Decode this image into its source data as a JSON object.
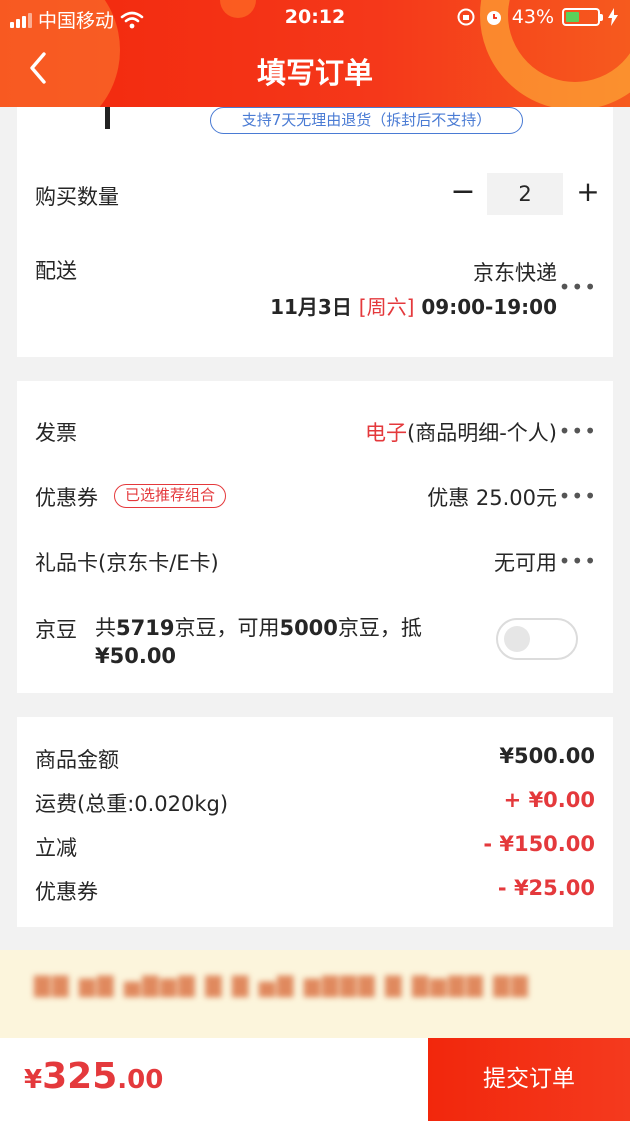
{
  "status_bar": {
    "carrier": "中国移动",
    "time": "20:12",
    "battery": "43%"
  },
  "header": {
    "title": "填写订单"
  },
  "order": {
    "return_policy": "支持7天无理由退货（拆封后不支持）",
    "quantity_label": "购买数量",
    "quantity_value": "2",
    "minus": "−",
    "plus": "+",
    "delivery_label": "配送",
    "delivery_method": "京东快递",
    "delivery_date": "11月3日",
    "delivery_weekday": "[周六]",
    "delivery_time": "09:00-19:00"
  },
  "options": {
    "invoice_label": "发票",
    "invoice_type": "电子",
    "invoice_detail": "(商品明细-个人)",
    "coupon_label": "优惠券",
    "coupon_badge": "已选推荐组合",
    "coupon_value": "优惠 25.00元",
    "giftcard_label": "礼品卡(京东卡/E卡)",
    "giftcard_value": "无可用",
    "jd_bean_label": "京豆",
    "jd_bean_prefix": "共",
    "jd_bean_total": "5719",
    "jd_bean_mid": "京豆，可用",
    "jd_bean_usable": "5000",
    "jd_bean_suffix": "京豆，抵",
    "jd_bean_amount": "¥50.00",
    "jd_bean_enabled": false
  },
  "summary": {
    "items": [
      {
        "label": "商品金额",
        "value": "¥500.00",
        "color": "#262626"
      },
      {
        "label": "运费(总重:0.020kg)",
        "value": "+ ¥0.00",
        "color": "#e4393c"
      },
      {
        "label": "立减",
        "value": "- ¥150.00",
        "color": "#e4393c"
      },
      {
        "label": "优惠券",
        "value": "- ¥25.00",
        "color": "#e4393c"
      }
    ]
  },
  "notice": {
    "text": "▇▇ ▆▇ ▅▇▆▇ ▇ ▇ ▅▇ ▆▇▇▇ ▇ ▇▆▇▇ ▇▇"
  },
  "bottom": {
    "currency": "¥",
    "total_int": "325",
    "total_dec": ".00",
    "submit_label": "提交订单"
  },
  "colors": {
    "brand_red": "#e4393c",
    "header_red": "#f2270c",
    "link_blue": "#4a7bd4"
  }
}
